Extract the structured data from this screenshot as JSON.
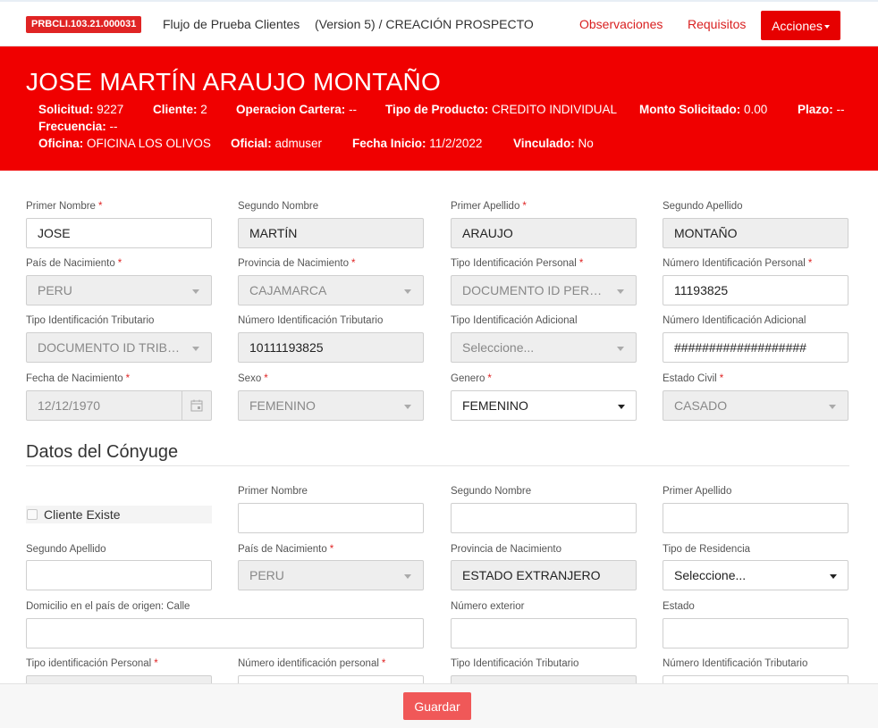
{
  "topbar": {
    "code": "PRBCLI.103.21.000031",
    "flow_title": "Flujo de Prueba Clientes",
    "flow_version": "(Version 5) / CREACIÓN PROSPECTO",
    "observaciones": "Observaciones",
    "requisitos": "Requisitos",
    "acciones": "Acciones"
  },
  "header": {
    "name": "JOSE MARTÍN ARAUJO MONTAÑO",
    "solicitud_label": "Solicitud:",
    "solicitud": "9227",
    "cliente_label": "Cliente:",
    "cliente": "2",
    "operacion_label": "Operacion Cartera:",
    "operacion": "--",
    "tipo_producto_label": "Tipo de Producto:",
    "tipo_producto": "CREDITO INDIVIDUAL",
    "monto_label": "Monto Solicitado:",
    "monto": "0.00",
    "plazo_label": "Plazo:",
    "plazo": "--",
    "frecuencia_label": "Frecuencia:",
    "frecuencia": "--",
    "oficina_label": "Oficina:",
    "oficina": "OFICINA LOS OLIVOS",
    "oficial_label": "Oficial:",
    "oficial": "admuser",
    "fecha_inicio_label": "Fecha Inicio:",
    "fecha_inicio": "11/2/2022",
    "vinculado_label": "Vinculado:",
    "vinculado": "No"
  },
  "form": {
    "primer_nombre": {
      "label": "Primer Nombre",
      "value": "JOSE"
    },
    "segundo_nombre": {
      "label": "Segundo Nombre",
      "value": "MARTÍN"
    },
    "primer_apellido": {
      "label": "Primer Apellido",
      "value": "ARAUJO"
    },
    "segundo_apellido": {
      "label": "Segundo Apellido",
      "value": "MONTAÑO"
    },
    "pais_nacimiento": {
      "label": "País de Nacimiento",
      "value": "PERU"
    },
    "provincia_nacimiento": {
      "label": "Provincia de Nacimiento",
      "value": "CAJAMARCA"
    },
    "tipo_id_personal": {
      "label": "Tipo Identificación Personal",
      "value": "DOCUMENTO ID PERSONAL"
    },
    "numero_id_personal": {
      "label": "Número Identificación Personal",
      "value": "11193825"
    },
    "tipo_id_tributario": {
      "label": "Tipo Identificación Tributario",
      "value": "DOCUMENTO ID TRIBUTARIO"
    },
    "numero_id_tributario": {
      "label": "Número Identificación Tributario",
      "value": "10111193825"
    },
    "tipo_id_adicional": {
      "label": "Tipo Identificación Adicional",
      "value": "Seleccione..."
    },
    "numero_id_adicional": {
      "label": "Número Identificación Adicional",
      "value": "###################"
    },
    "fecha_nacimiento": {
      "label": "Fecha de Nacimiento",
      "value": "12/12/1970"
    },
    "sexo": {
      "label": "Sexo",
      "value": "FEMENINO"
    },
    "genero": {
      "label": "Genero",
      "value": "FEMENINO"
    },
    "estado_civil": {
      "label": "Estado Civil",
      "value": "CASADO"
    }
  },
  "conyuge": {
    "section_title": "Datos del Cónyuge",
    "cliente_existe": "Cliente Existe",
    "primer_nombre": {
      "label": "Primer Nombre",
      "value": ""
    },
    "segundo_nombre": {
      "label": "Segundo Nombre",
      "value": ""
    },
    "primer_apellido": {
      "label": "Primer Apellido",
      "value": ""
    },
    "segundo_apellido": {
      "label": "Segundo Apellido",
      "value": ""
    },
    "pais_nacimiento": {
      "label": "País de Nacimiento",
      "value": "PERU"
    },
    "provincia_nacimiento": {
      "label": "Provincia de Nacimiento",
      "value": "ESTADO EXTRANJERO"
    },
    "tipo_residencia": {
      "label": "Tipo de Residencia",
      "value": "Seleccione..."
    },
    "domicilio": {
      "label": "Domicilio en el país de origen: Calle",
      "value": ""
    },
    "numero_exterior": {
      "label": "Número exterior",
      "value": ""
    },
    "estado": {
      "label": "Estado",
      "value": ""
    },
    "tipo_id_personal": {
      "label": "Tipo identificación Personal"
    },
    "numero_id_personal": {
      "label": "Número identificación personal"
    },
    "tipo_id_tributario": {
      "label": "Tipo Identificación Tributario"
    },
    "numero_id_tributario": {
      "label": "Número Identificación Tributario"
    }
  },
  "footer": {
    "guardar": "Guardar"
  }
}
